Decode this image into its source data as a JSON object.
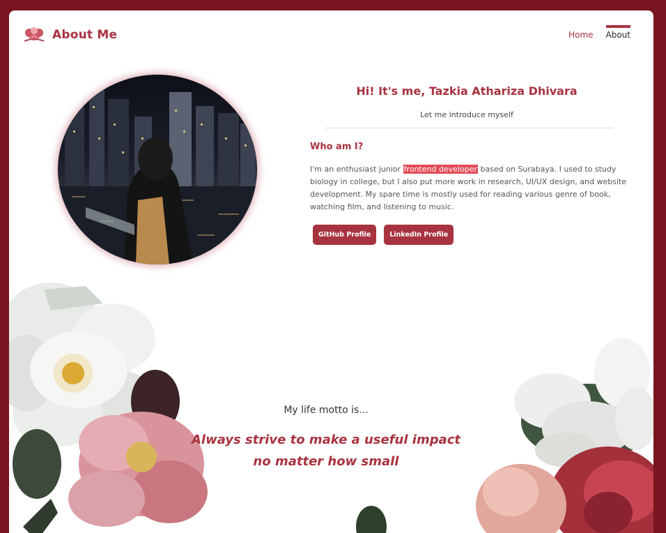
{
  "nav": {
    "brand_title": "About Me",
    "links": [
      {
        "label": "Home",
        "active": false
      },
      {
        "label": "About",
        "active": true
      }
    ]
  },
  "intro": {
    "title": "Hi! It's me, Tazkia Athariza Dhivara",
    "subtitle": "Let me introduce myself",
    "heading": "Who am I?",
    "bio_before": "I'm an enthusiast junior ",
    "bio_highlight": "frontend developer",
    "bio_after": " based on Surabaya. I used to study biology in college, but I also put more work in research, UI/UX design, and website development. My spare time is mostly used for reading various genre of book, watching film, and listening to music."
  },
  "buttons": {
    "github": "GitHub Profile",
    "linkedin": "LinkedIn Profile"
  },
  "motto": {
    "lead": "My life motto is...",
    "line1": "Always strive to make a useful impact",
    "line2": "no matter how small"
  },
  "colors": {
    "page_background": "#7a1420",
    "accent": "#a83340",
    "highlight": "#e24a56"
  }
}
